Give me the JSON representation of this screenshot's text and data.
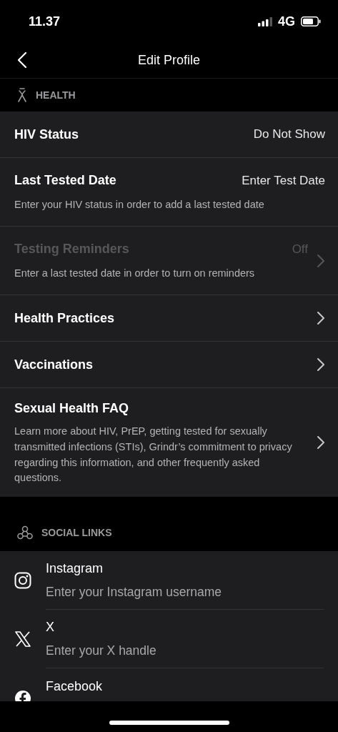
{
  "status_bar": {
    "time": "11.37",
    "network": "4G"
  },
  "header": {
    "title": "Edit Profile"
  },
  "health": {
    "heading": "HEALTH",
    "rows": [
      {
        "kind": "value",
        "title": "HIV Status",
        "value": "Do Not Show",
        "disabled": false
      },
      {
        "kind": "value",
        "title": "Last Tested Date",
        "value": "Enter Test Date",
        "note": "Enter your HIV status in order to add a last tested date",
        "disabled": false
      },
      {
        "kind": "link",
        "title": "Testing Reminders",
        "value": "Off",
        "note": "Enter a last tested date in order to turn on reminders",
        "disabled": true
      },
      {
        "kind": "link",
        "title": "Health Practices",
        "disabled": false
      },
      {
        "kind": "link",
        "title": "Vaccinations",
        "disabled": false
      },
      {
        "kind": "link",
        "title": "Sexual Health FAQ",
        "note": "Learn more about HIV, PrEP, getting tested for sexually transmitted infections (STIs), Grindr’s commitment to privacy regarding this information, and other frequently asked questions.",
        "disabled": false
      }
    ]
  },
  "social_links": {
    "heading": "SOCIAL LINKS",
    "items": [
      {
        "kind": "instagram",
        "label": "Instagram",
        "placeholder": "Enter your Instagram username"
      },
      {
        "kind": "x",
        "label": "X",
        "placeholder": "Enter your X handle"
      },
      {
        "kind": "facebook",
        "label": "Facebook"
      }
    ]
  }
}
